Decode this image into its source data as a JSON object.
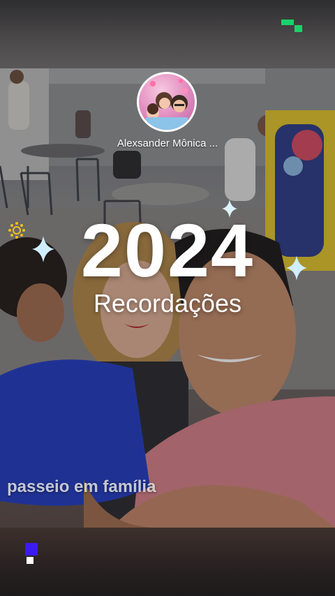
{
  "story": {
    "profile_name": "Alexsander Mônica ...",
    "year": "2024",
    "title": "Recordações",
    "caption": "passeio em família"
  },
  "icons": {
    "top_right": "app-logo-icon",
    "bottom_left": "app-logo-icon",
    "decorations": [
      "sparkle-icon",
      "sun-icon"
    ]
  },
  "colors": {
    "logo_green": "#18d36b",
    "logo_blue": "#3b1cf0",
    "text": "#ffffff"
  }
}
